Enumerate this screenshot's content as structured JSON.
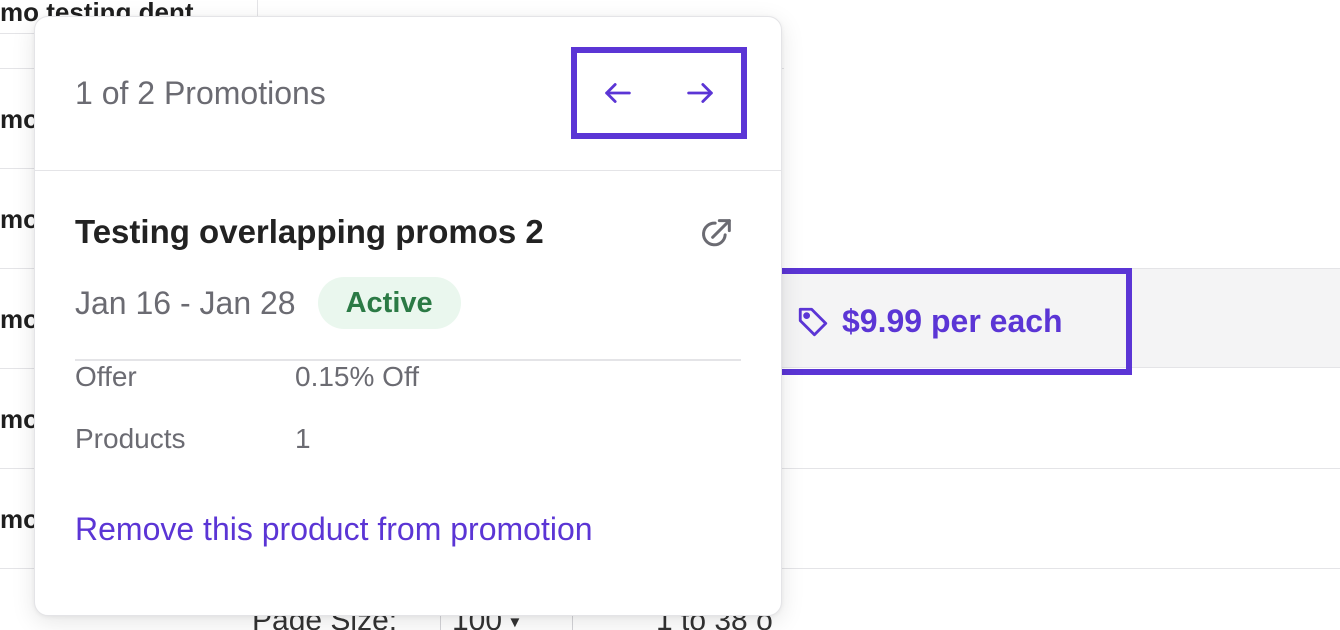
{
  "background": {
    "tab_label": "mo testing dent",
    "row_labels": [
      "mo",
      "mo",
      "mo",
      "mo",
      "mo"
    ],
    "price_label": "$9.99 per each",
    "footer": {
      "page_size_label": "Page Size:",
      "page_size_value": "100",
      "range_text": "1 to 38 o"
    }
  },
  "popover": {
    "counter": "1 of 2 Promotions",
    "prev_icon": "arrow-left-icon",
    "next_icon": "arrow-right-icon",
    "promo_title": "Testing overlapping promos 2",
    "open_icon": "external-link-icon",
    "date_range": "Jan 16 - Jan 28",
    "status": "Active",
    "details": [
      {
        "label": "Offer",
        "value": "0.15% Off"
      },
      {
        "label": "Products",
        "value": "1"
      }
    ],
    "remove_link": "Remove this product from promotion"
  },
  "colors": {
    "accent": "#5b35d5",
    "status_bg": "#eaf7ee",
    "status_text": "#2b7a45",
    "muted_text": "#6b6b72"
  }
}
